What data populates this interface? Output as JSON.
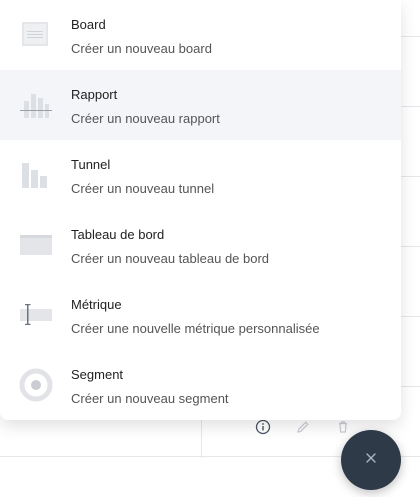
{
  "menu": {
    "items": [
      {
        "title": "Board",
        "description": "Créer un nouveau board",
        "icon": "board-icon"
      },
      {
        "title": "Rapport",
        "description": "Créer un nouveau rapport",
        "icon": "report-icon"
      },
      {
        "title": "Tunnel",
        "description": "Créer un nouveau tunnel",
        "icon": "funnel-icon"
      },
      {
        "title": "Tableau de bord",
        "description": "Créer un nouveau tableau de bord",
        "icon": "dashboard-icon"
      },
      {
        "title": "Métrique",
        "description": "Créer une nouvelle métrique personnalisée",
        "icon": "metric-icon"
      },
      {
        "title": "Segment",
        "description": "Créer un nouveau segment",
        "icon": "segment-icon"
      }
    ]
  },
  "row_actions": {
    "icons": [
      "info-icon",
      "edit-icon",
      "trash-icon"
    ]
  },
  "fab": {
    "icon": "close-icon"
  },
  "colors": {
    "fab_background": "#2f3a49",
    "hover_background": "#f4f5f8",
    "icon_gray": "#e1e3e6"
  }
}
